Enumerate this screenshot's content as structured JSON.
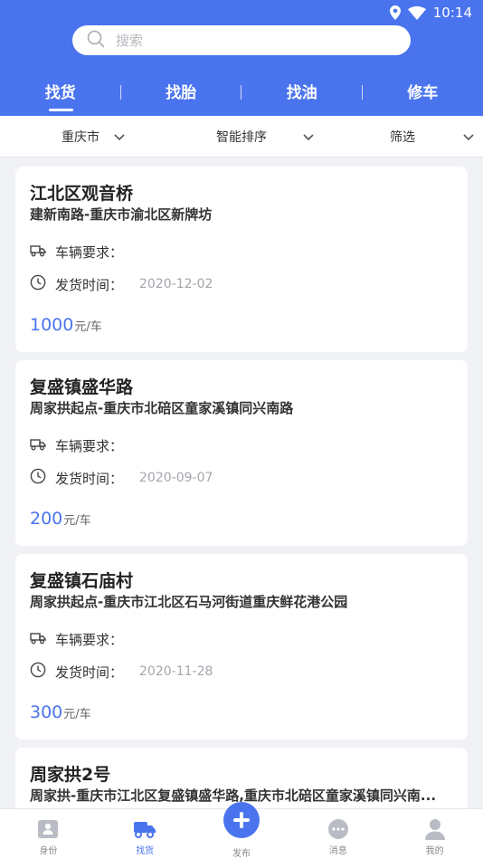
{
  "status": {
    "time": "10:14"
  },
  "search": {
    "placeholder": "搜索"
  },
  "tabs": [
    {
      "label": "找货",
      "active": true
    },
    {
      "label": "找胎",
      "active": false
    },
    {
      "label": "找油",
      "active": false
    },
    {
      "label": "修车",
      "active": false
    }
  ],
  "filters": [
    {
      "label": "重庆市"
    },
    {
      "label": "智能排序"
    },
    {
      "label": "筛选"
    }
  ],
  "cards": [
    {
      "title": "江北区观音桥",
      "route": "建新南路-重庆市渝北区新牌坊",
      "vehicle_label": "车辆要求：",
      "vehicle_value": "",
      "time_label": "发货时间：",
      "time_value": "2020-12-02",
      "price": "1000",
      "unit": "元/车"
    },
    {
      "title": "复盛镇盛华路",
      "route": "周家拱起点-重庆市北碚区童家溪镇同兴南路",
      "vehicle_label": "车辆要求：",
      "vehicle_value": "",
      "time_label": "发货时间：",
      "time_value": "2020-09-07",
      "price": "200",
      "unit": "元/车"
    },
    {
      "title": "复盛镇石庙村",
      "route": "周家拱起点-重庆市江北区石马河街道重庆鲜花港公园",
      "vehicle_label": "车辆要求：",
      "vehicle_value": "",
      "time_label": "发货时间：",
      "time_value": "2020-11-28",
      "price": "300",
      "unit": "元/车"
    },
    {
      "title": "周家拱2号",
      "route": "周家拱-重庆市江北区复盛镇盛华路,重庆市北碚区童家溪镇同兴南..."
    }
  ],
  "nav": [
    {
      "label": "身份",
      "icon": "id-icon",
      "active": false
    },
    {
      "label": "找货",
      "icon": "truck-icon",
      "active": true
    },
    {
      "label": "发布",
      "icon": "plus-icon",
      "active": false
    },
    {
      "label": "消息",
      "icon": "message-icon",
      "active": false
    },
    {
      "label": "我的",
      "icon": "user-icon",
      "active": false
    }
  ],
  "colors": {
    "primary": "#4a74ee",
    "background": "#f1f2f6"
  }
}
